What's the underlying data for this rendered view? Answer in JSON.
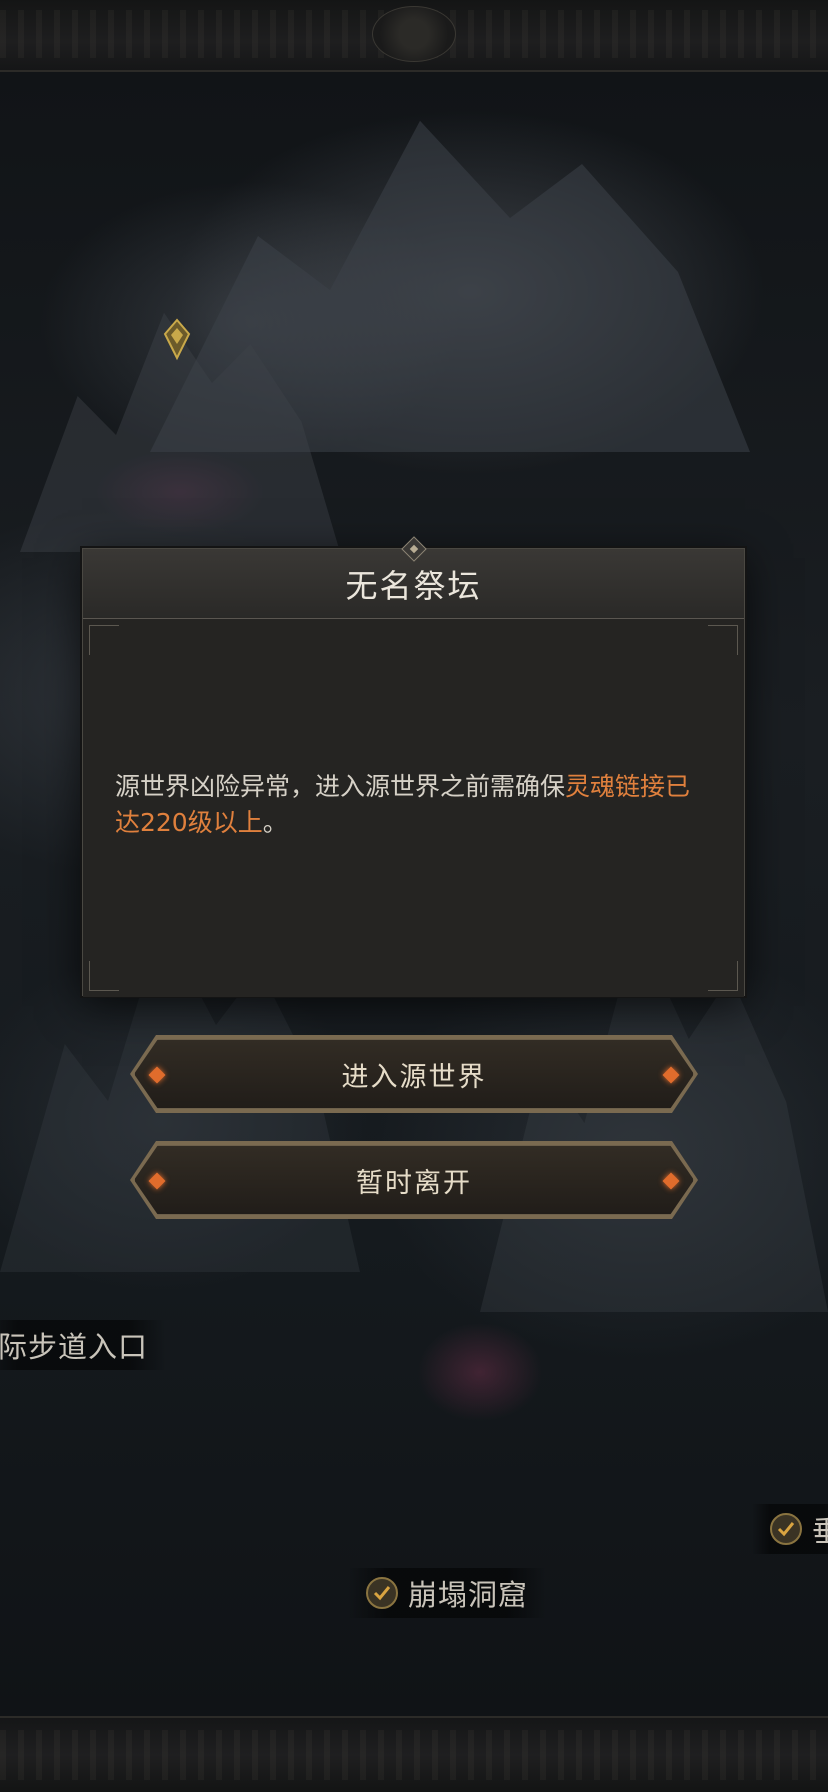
{
  "dialog": {
    "title": "无名祭坛",
    "message_prefix": "源世界凶险异常，进入源世界之前需确保",
    "message_highlight": "灵魂链接已达220级以上",
    "message_suffix": "。"
  },
  "buttons": {
    "enter_label": "进入源世界",
    "leave_label": "暂时离开"
  },
  "map": {
    "labels": {
      "path_entrance": "际步道入口",
      "collapsed_cave": "崩塌洞窟",
      "right_partial": "垂"
    }
  },
  "colors": {
    "highlight": "#e0803d",
    "button_gem": "#e06c2c",
    "background": "#0d0f12"
  },
  "icons": [
    "map-pin-icon",
    "check-icon",
    "diamond-gem-icon"
  ]
}
